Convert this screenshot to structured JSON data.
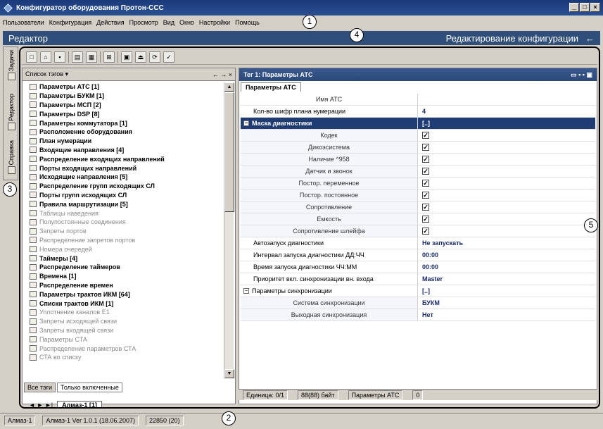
{
  "window": {
    "title": "Конфигуратор оборудования Протон-ССС",
    "controls": [
      "_",
      "□",
      "×"
    ]
  },
  "menu": [
    "Пользователи",
    "Конфигурация",
    "Действия",
    "Просмотр",
    "Вид",
    "Окно",
    "Настройки",
    "Помощь"
  ],
  "callouts": [
    "1",
    "2",
    "3",
    "4",
    "5"
  ],
  "editor": {
    "title": "Редактор",
    "subtitle": "Редактирование конфигурации",
    "back": "←"
  },
  "side_tabs": [
    "Задачи",
    "Редактор",
    "Справка"
  ],
  "left_pane": {
    "header": "Список тэгов",
    "items": [
      {
        "label": "Параметры АТС [1]",
        "style": "bold"
      },
      {
        "label": "Параметры БУКМ [1]",
        "style": "bold"
      },
      {
        "label": "Параметры МСП [2]",
        "style": "bold"
      },
      {
        "label": "Параметры DSP [8]",
        "style": "bold"
      },
      {
        "label": "Параметры коммутатора [1]",
        "style": "bold"
      },
      {
        "label": "Расположение оборудования",
        "style": "bold"
      },
      {
        "label": "План нумерации",
        "style": "bold"
      },
      {
        "label": "Входящие направления [4]",
        "style": "bold"
      },
      {
        "label": "Распределение входящих направлений",
        "style": "bold"
      },
      {
        "label": "Порты входящих направлений",
        "style": "bold"
      },
      {
        "label": "Исходящие направления [5]",
        "style": "bold"
      },
      {
        "label": "Распределение групп исходящих СЛ",
        "style": "bold"
      },
      {
        "label": "Порты групп исходящих СЛ",
        "style": "bold"
      },
      {
        "label": "Правила маршрутизации [5]",
        "style": "bold"
      },
      {
        "label": "Таблицы наведения",
        "style": "gray"
      },
      {
        "label": "Полупостоянные соединения",
        "style": "gray"
      },
      {
        "label": "Запреты портов",
        "style": "gray"
      },
      {
        "label": "Распределение запретов портов",
        "style": "gray"
      },
      {
        "label": "Номера очередей",
        "style": "gray"
      },
      {
        "label": "Таймеры [4]",
        "style": "bold"
      },
      {
        "label": "Распределение таймеров",
        "style": "bold"
      },
      {
        "label": "Времена [1]",
        "style": "bold"
      },
      {
        "label": "Распределение времен",
        "style": "bold"
      },
      {
        "label": "Параметры трактов ИКМ [64]",
        "style": "bold"
      },
      {
        "label": "Списки трактов ИКМ [1]",
        "style": "bold"
      },
      {
        "label": "Уплотнение каналов Е1",
        "style": "gray"
      },
      {
        "label": "Запреты исходящей связи",
        "style": "gray"
      },
      {
        "label": "Запреты входящей связи",
        "style": "gray"
      },
      {
        "label": "Параметры СТА",
        "style": "gray"
      },
      {
        "label": "Распределение параметров СТА",
        "style": "gray"
      },
      {
        "label": "СТА во списку",
        "style": "gray"
      }
    ],
    "tabs": [
      "Все тэги",
      "Только включенные"
    ],
    "doc_tab": "Алмаз-1 [1]"
  },
  "right_pane": {
    "header": "Тег 1: Параметры АТС",
    "subtab": "Параметры АТС",
    "rows": [
      {
        "key": "Имя АТС",
        "value": "",
        "type": "plain"
      },
      {
        "key": "Кол-во шифр плана нумерации",
        "value": "4",
        "type": "plain"
      },
      {
        "key": "Маска диагностики",
        "value": "[..]",
        "type": "category"
      },
      {
        "key": "Кодек",
        "value": "✓",
        "type": "check"
      },
      {
        "key": "Дикоэсистема",
        "value": "✓",
        "type": "check"
      },
      {
        "key": "Наличие ^958",
        "value": "✓",
        "type": "check"
      },
      {
        "key": "Датчик и звонок",
        "value": "✓",
        "type": "check"
      },
      {
        "key": "Постор. переменное",
        "value": "✓",
        "type": "check"
      },
      {
        "key": "Постор. постоянное",
        "value": "✓",
        "type": "check"
      },
      {
        "key": "Сопротивление",
        "value": "✓",
        "type": "check"
      },
      {
        "key": "Емкость",
        "value": "✓",
        "type": "check"
      },
      {
        "key": "Сопротивление шлейфа",
        "value": "✓",
        "type": "check"
      },
      {
        "key": "Автозапуск диагностики",
        "value": "Не запускать",
        "type": "plain"
      },
      {
        "key": "Интервал запуска диагностики ДД:ЧЧ",
        "value": "00:00",
        "type": "plain"
      },
      {
        "key": "Время запуска диагностики ЧЧ:ММ",
        "value": "00:00",
        "type": "plain"
      },
      {
        "key": "Приоритет вкл. синхронизации вн. входа",
        "value": "Master",
        "type": "plain"
      },
      {
        "key": "Параметры синхронизации",
        "value": "[..]",
        "type": "group"
      },
      {
        "key": "Система синхронизации",
        "value": "БУКМ",
        "type": "sub"
      },
      {
        "key": "Выходная синхронизация",
        "value": "Нет",
        "type": "sub"
      }
    ]
  },
  "inner_status": {
    "unit": "Единица: 0/1",
    "bytes": "88(88) байт",
    "tag": "Параметры АТС",
    "count": "0"
  },
  "status_bar": {
    "station": "Алмаз-1",
    "version": "Алмаз-1 Ver 1.0.1 (18.06.2007)",
    "memory": "22850 (20)"
  },
  "colors": {
    "titlebar": "#1a3a78",
    "editorbar": "#2f4f7a",
    "category_row": "#203c74",
    "value_text": "#1a2a6a"
  }
}
